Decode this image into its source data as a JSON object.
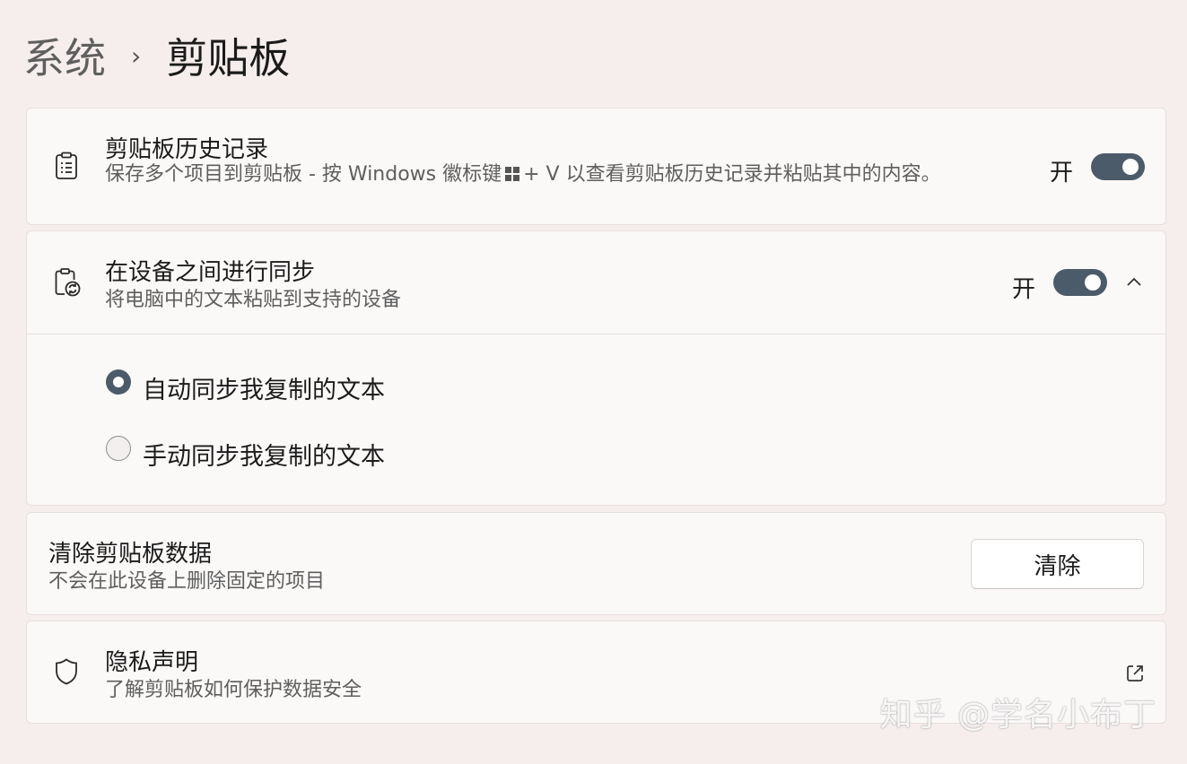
{
  "breadcrumb": {
    "parent": "系统",
    "separator": "›",
    "current": "剪贴板"
  },
  "history": {
    "icon": "clipboard-list-icon",
    "title": "剪贴板历史记录",
    "desc_before_logo": "保存多个项目到剪贴板 - 按 Windows 徽标键",
    "desc_after_logo": "+ V 以查看剪贴板历史记录并粘贴其中的内容。",
    "toggle_label": "开",
    "toggle_on": true
  },
  "sync": {
    "icon": "clipboard-sync-icon",
    "title": "在设备之间进行同步",
    "desc": "将电脑中的文本粘贴到支持的设备",
    "toggle_label": "开",
    "toggle_on": true,
    "expanded": true,
    "options": [
      {
        "label": "自动同步我复制的文本",
        "checked": true
      },
      {
        "label": "手动同步我复制的文本",
        "checked": false
      }
    ]
  },
  "clear": {
    "title": "清除剪贴板数据",
    "desc": "不会在此设备上删除固定的项目",
    "button_label": "清除"
  },
  "privacy": {
    "icon": "shield-icon",
    "title": "隐私声明",
    "desc": "了解剪贴板如何保护数据安全"
  },
  "watermark": "知乎 @学名小布丁",
  "colors": {
    "background": "#f5eeec",
    "card": "#fbf9f8",
    "accent": "#4c5b69"
  }
}
